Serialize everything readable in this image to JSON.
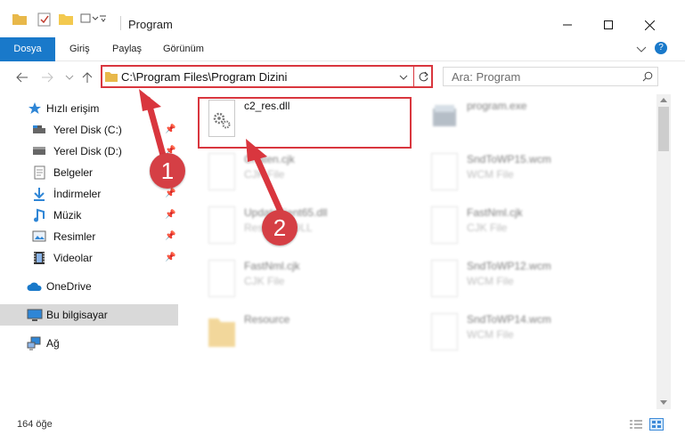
{
  "window": {
    "title": "Program"
  },
  "ribbon": {
    "tabs": [
      "Dosya",
      "Giriş",
      "Paylaş",
      "Görünüm"
    ]
  },
  "address": {
    "path": "C:\\Program Files\\Program Dizini"
  },
  "search": {
    "placeholder": "Ara: Program"
  },
  "sidebar": {
    "quick_access": "Hızlı erişim",
    "items": [
      {
        "label": "Yerel Disk (C:)"
      },
      {
        "label": "Yerel Disk (D:)"
      },
      {
        "label": "Belgeler"
      },
      {
        "label": "İndirmeler"
      },
      {
        "label": "Müzik"
      },
      {
        "label": "Resimler"
      },
      {
        "label": "Videolar"
      }
    ],
    "onedrive": "OneDrive",
    "this_pc": "Bu bilgisayar",
    "network": "Ağ"
  },
  "files": {
    "left": [
      {
        "name": "c2_res.dll",
        "type": ""
      },
      {
        "name": "Chaten.cjk",
        "type": "CJK File"
      },
      {
        "name": "Update4ient65.dll",
        "type": "Resource DLL"
      },
      {
        "name": "FastNml.cjk",
        "type": "CJK File"
      },
      {
        "name": "Resource",
        "type": ""
      }
    ],
    "right": [
      {
        "name": "program.exe",
        "type": ""
      },
      {
        "name": "SndToWP15.wcm",
        "type": "WCM File"
      },
      {
        "name": "FastNml.cjk",
        "type": "CJK File"
      },
      {
        "name": "SndToWP12.wcm",
        "type": "WCM File"
      },
      {
        "name": "SndToWP14.wcm",
        "type": "WCM File"
      }
    ]
  },
  "status": {
    "count": "164 öğe"
  },
  "badges": {
    "one": "1",
    "two": "2"
  },
  "colors": {
    "accent": "#1979ca",
    "highlight": "#d9363e"
  }
}
